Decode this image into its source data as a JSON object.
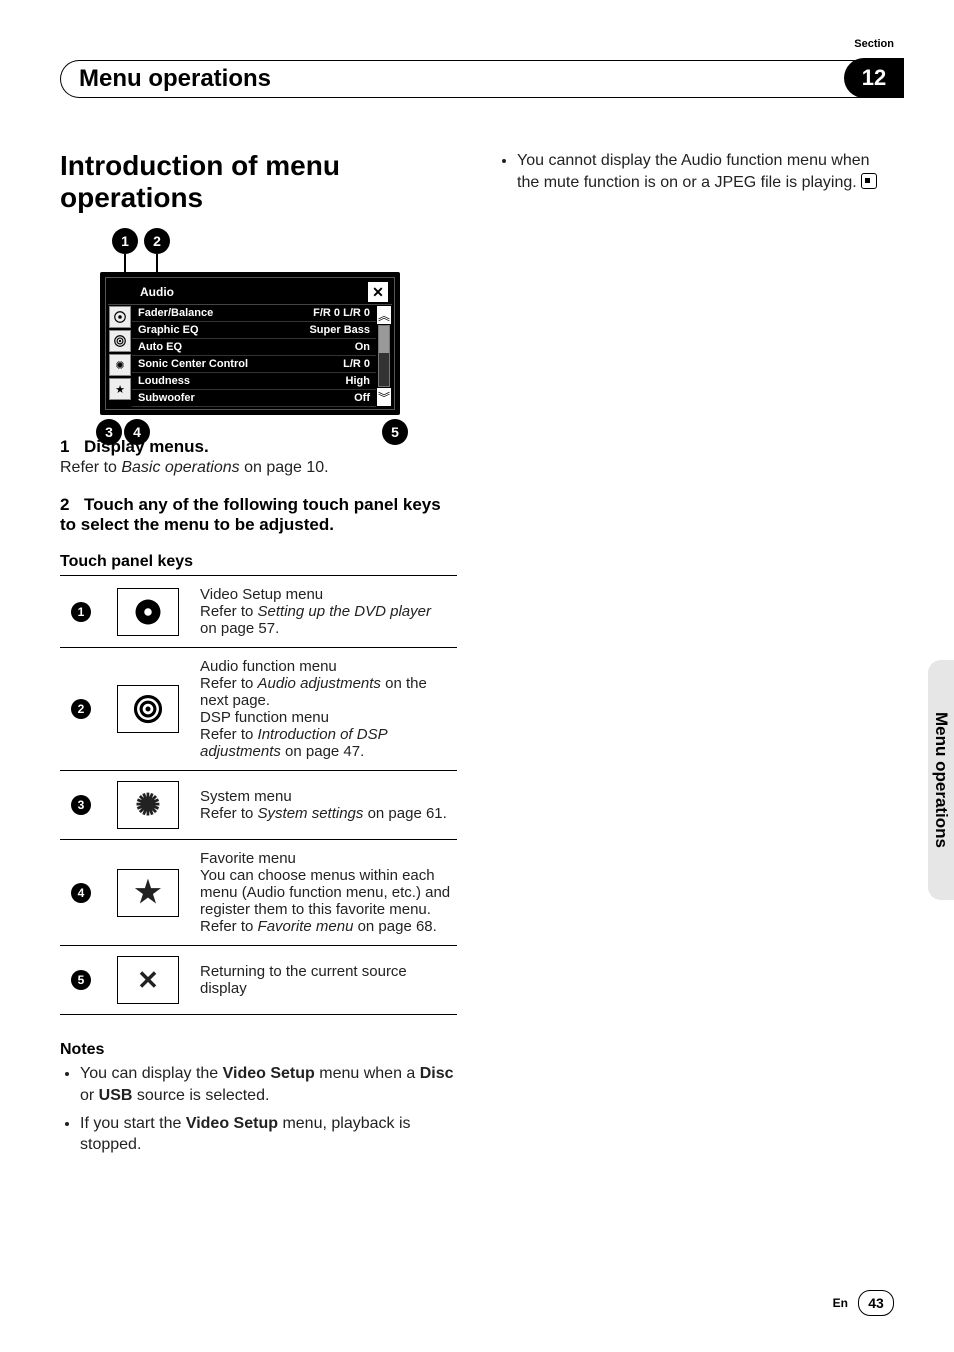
{
  "header": {
    "title": "Menu operations",
    "section_label": "Section",
    "section_number": "12"
  },
  "side_tab": "Menu operations",
  "footer": {
    "lang": "En",
    "page": "43"
  },
  "intro": {
    "heading": "Introduction of menu operations"
  },
  "screenshot": {
    "title": "Audio",
    "rows": [
      {
        "label": "Fader/Balance",
        "value": "F/R  0 L/R  0"
      },
      {
        "label": "Graphic EQ",
        "value": "Super Bass"
      },
      {
        "label": "Auto EQ",
        "value": "On"
      },
      {
        "label": "Sonic Center Control",
        "value": "L/R 0"
      },
      {
        "label": "Loudness",
        "value": "High"
      },
      {
        "label": "Subwoofer",
        "value": "Off"
      }
    ],
    "callouts": {
      "c1": "1",
      "c2": "2",
      "c3": "3",
      "c4": "4",
      "c5": "5"
    }
  },
  "steps": {
    "s1": {
      "num": "1",
      "title": "Display menus.",
      "body_pre": "Refer to ",
      "body_em": "Basic operations",
      "body_post": " on page 10."
    },
    "s2": {
      "num": "2",
      "title": "Touch any of the following touch panel keys to select the menu to be adjusted."
    }
  },
  "tpk_title": "Touch panel keys",
  "tpk": [
    {
      "n": "1",
      "desc_pre": "Video Setup menu\nRefer to ",
      "desc_em": "Setting up the DVD player",
      "desc_post": " on page 57."
    },
    {
      "n": "2",
      "desc_pre": "Audio function menu\nRefer to ",
      "desc_em": "Audio adjustments",
      "desc_mid": " on the next page.\nDSP function menu\nRefer to ",
      "desc_em2": "Introduction of DSP adjustments",
      "desc_post": " on page 47."
    },
    {
      "n": "3",
      "desc_pre": "System menu\nRefer to ",
      "desc_em": "System settings",
      "desc_post": " on page 61."
    },
    {
      "n": "4",
      "desc_pre": "Favorite menu\nYou can choose menus within each menu (Audio function menu, etc.) and register them to this favorite menu.\nRefer to ",
      "desc_em": "Favorite menu",
      "desc_post": " on page 68."
    },
    {
      "n": "5",
      "desc_pre": "Returning to the current source display",
      "desc_em": "",
      "desc_post": ""
    }
  ],
  "notes": {
    "title": "Notes",
    "items": {
      "n1_a": "You can display the ",
      "n1_b": "Video Setup",
      "n1_c": " menu when a ",
      "n1_d": "Disc",
      "n1_e": " or ",
      "n1_f": "USB",
      "n1_g": " source is selected.",
      "n2_a": "If you start the ",
      "n2_b": "Video Setup",
      "n2_c": " menu, playback is stopped."
    }
  },
  "right_col": {
    "bullet": "You cannot display the Audio function menu when the mute function is on or a JPEG file is playing."
  }
}
